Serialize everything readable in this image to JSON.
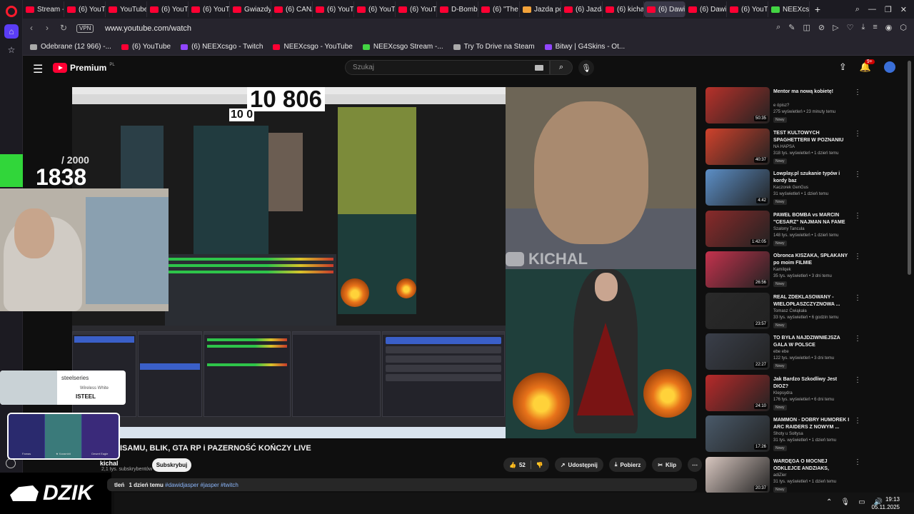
{
  "browser": {
    "tabs": [
      {
        "label": "Stream - I",
        "icon": "youtube-icon",
        "color": "#ff0033"
      },
      {
        "label": "(6) YouTu",
        "icon": "youtube-icon",
        "color": "#ff0033"
      },
      {
        "label": "YouTube",
        "icon": "youtube-icon",
        "color": "#ff0033"
      },
      {
        "label": "(6) YouTu",
        "icon": "youtube-icon",
        "color": "#ff0033"
      },
      {
        "label": "(6) YouTu",
        "icon": "youtube-icon",
        "color": "#ff0033"
      },
      {
        "label": "Gwiazdy",
        "icon": "youtube-icon",
        "color": "#ff0033"
      },
      {
        "label": "(6) CANA",
        "icon": "youtube-icon",
        "color": "#ff0033"
      },
      {
        "label": "(6) YouTu",
        "icon": "youtube-icon",
        "color": "#ff0033"
      },
      {
        "label": "(6) YouTu",
        "icon": "youtube-icon",
        "color": "#ff0033"
      },
      {
        "label": "(6) YouTu",
        "icon": "youtube-icon",
        "color": "#ff0033"
      },
      {
        "label": "D-Bomb",
        "icon": "youtube-icon",
        "color": "#ff0033"
      },
      {
        "label": "(6) \"The",
        "icon": "youtube-icon",
        "color": "#ff0033"
      },
      {
        "label": "Jazda po",
        "icon": "generic-icon",
        "color": "#f2a23a"
      },
      {
        "label": "(6) Jazda",
        "icon": "youtube-icon",
        "color": "#ff0033"
      },
      {
        "label": "(6) kichal",
        "icon": "youtube-icon",
        "color": "#ff0033"
      },
      {
        "label": "(6) Dawid Ja",
        "icon": "youtube-icon",
        "color": "#ff0033",
        "active": true
      },
      {
        "label": "(6) Dawid",
        "icon": "youtube-icon",
        "color": "#ff0033"
      },
      {
        "label": "(6) YouTu",
        "icon": "youtube-icon",
        "color": "#ff0033"
      },
      {
        "label": "NEEXcsgo",
        "icon": "kick-icon",
        "color": "#43d443"
      }
    ],
    "url": "www.youtube.com/watch",
    "vpn_label": "VPN",
    "bookmarks": [
      {
        "label": "Odebrane (12 966) -...",
        "icon": "mail-icon"
      },
      {
        "label": "(6) YouTube",
        "icon": "youtube-icon"
      },
      {
        "label": "(6) NEEXcsgo - Twitch",
        "icon": "twitch-icon"
      },
      {
        "label": "NEEXcsgo - YouTube",
        "icon": "youtube-icon"
      },
      {
        "label": "NEEXcsgo Stream -...",
        "icon": "kick-icon"
      },
      {
        "label": "Try To Drive na Steam",
        "icon": "steam-icon"
      },
      {
        "label": "Bitwy | G4Skins - Ot...",
        "icon": "g4skins-icon"
      }
    ]
  },
  "youtube": {
    "logo_text": "Premium",
    "logo_region": "PL",
    "search_placeholder": "Szukaj",
    "notification_count": "9+",
    "video": {
      "overlay_counter": "10 806",
      "overlay_counter_small": "10 0",
      "watermark": "KICHAL",
      "sub_goal_target": "/ 2000",
      "sub_goal_current": "1838",
      "sponsor_brand": "steelseries",
      "sponsor_product": "Wireless White",
      "sponsor_tag": "ISTEEL",
      "case_slots": [
        "Famas",
        "★ Karambit",
        "Desert Eagle"
      ],
      "dzik_text": "DZIK"
    },
    "title": "ISAMU, BLIK, GTA RP i PAZERNOŚĆ KOŃCZY LIVE",
    "channel": {
      "name": "kichal",
      "subs": "2,1 tys. subskrybentów"
    },
    "subscribe_label": "Subskrybuj",
    "actions": {
      "likes": "52",
      "share": "Udostępnij",
      "download": "Pobierz",
      "clip": "Klip"
    },
    "description": {
      "views": "tleń",
      "age": "1 dzień temu",
      "tags": "#dawidjasper #jasper #twitch"
    },
    "recommendations": [
      {
        "title": "Mentor ma nową kobietę!",
        "channel": "e ópisz?",
        "meta": "275 wyświetleń • 23 minuty temu",
        "badge": "Nowy",
        "duration": "50:35",
        "thumb_color": "#b8312a"
      },
      {
        "title": "TEST KULTOWYCH SPAGHETTERII W POZNANIU",
        "channel": "NA HAPSA",
        "meta": "318 tys. wyświetleń • 1 dzień temu",
        "badge": "Nowy",
        "duration": "40:37",
        "thumb_color": "#d0422c"
      },
      {
        "title": "Lowplay.pl szukanie typów i kordy baz",
        "channel": "Kaczorek GenGus",
        "meta": "31 wyświetleń • 1 dzień temu",
        "badge": "Nowy",
        "duration": "4:42",
        "thumb_color": "#5c8fc7"
      },
      {
        "title": "PAWEŁ BOMBA vs MARCIN \"CESARZ\" NAJMAN NA FAME ...",
        "channel": "Szalony Tancula",
        "meta": "148 tys. wyświetleń • 1 dzień temu",
        "badge": "Nowy",
        "duration": "1:42:05",
        "thumb_color": "#8a2a2a"
      },
      {
        "title": "Obronca KISZAKA, SPŁAKANY po moim FILMIE",
        "channel": "Kamilqek",
        "meta": "35 tys. wyświetleń • 3 dni temu",
        "badge": "Nowy",
        "duration": "26:56",
        "thumb_color": "#c4324d"
      },
      {
        "title": "REAL ZDEKLASOWANY - WIELOPŁASZCZYZNOWA ...",
        "channel": "Tomasz Ćwiąkała",
        "meta": "33 tys. wyświetleń • 6 godzin temu",
        "badge": "Nowy",
        "duration": "23:57",
        "thumb_color": "#2a2a2a"
      },
      {
        "title": "TO BYŁA NAJDZIWNIEJSZA GALA W POLSCE",
        "channel": "ebe ebe",
        "meta": "122 tys. wyświetleń • 3 dni temu",
        "badge": "Nowy",
        "duration": "22:27",
        "thumb_color": "#3a3f4a"
      },
      {
        "title": "Jak Bardzo Szkodliwy Jest DIOZ?",
        "channel": "Klepsydra",
        "meta": "176 tys. wyświetleń • 6 dni temu",
        "badge": "Nowy",
        "duration": "24:10",
        "thumb_color": "#b82a2a"
      },
      {
        "title": "MAMMON - DOBRY HUMOREK I ARC RAIDERS Z NOWYM ...",
        "channel": "Shoty u Sołtysa",
        "meta": "31 tys. wyświetleń • 1 dzień temu",
        "badge": "Nowy",
        "duration": "17:26",
        "thumb_color": "#4a5a6a"
      },
      {
        "title": "WARDĘGA O MOCNEJ ODKLEJCE ANDZIAKS, UPADE...",
        "channel": "adiZier",
        "meta": "31 tys. wyświetleń • 1 dzień temu",
        "badge": "Nowy",
        "duration": "20:37",
        "thumb_color": "#d8c7c0"
      }
    ]
  },
  "taskbar": {
    "time": "19:13",
    "date": "05.11.2025"
  }
}
